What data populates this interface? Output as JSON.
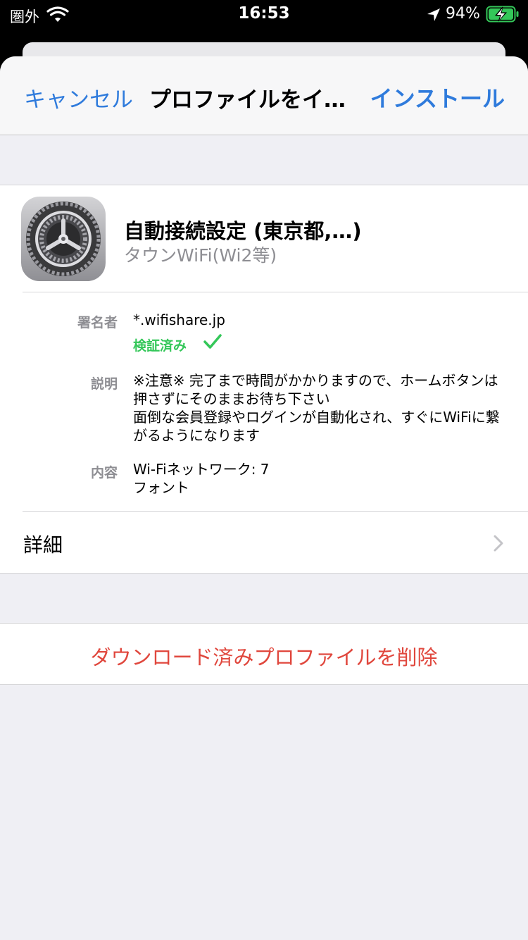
{
  "status_bar": {
    "carrier": "圏外",
    "time": "16:53",
    "battery": "94%"
  },
  "navbar": {
    "cancel": "キャンセル",
    "title": "プロファイルをイ…",
    "install": "インストール"
  },
  "profile": {
    "icon": "settings-gear-icon",
    "name": "自動接続設定 (東京都,…)",
    "subtitle": "タウンWiFi(Wi2等)"
  },
  "details": {
    "signer_label": "署名者",
    "signer_value": "*.wifishare.jp",
    "verified": "検証済み",
    "description_label": "説明",
    "description_lines": [
      "※注意※ 完了まで時間がかかりますので、ホームボタンは",
      "押さずにそのままお待ち下さい",
      "面倒な会員登録やログインが自動化され、すぐにWiFiに繋",
      "がるようになります"
    ],
    "contents_label": "内容",
    "contents_lines": [
      "Wi-Fiネットワーク: 7",
      "フォント"
    ]
  },
  "more_details": "詳細",
  "delete_button": "ダウンロード済みプロファイルを削除",
  "colors": {
    "accent": "#2f7bdc",
    "destructive": "#e0473d",
    "verified": "#34c759",
    "background": "#efeff4"
  }
}
